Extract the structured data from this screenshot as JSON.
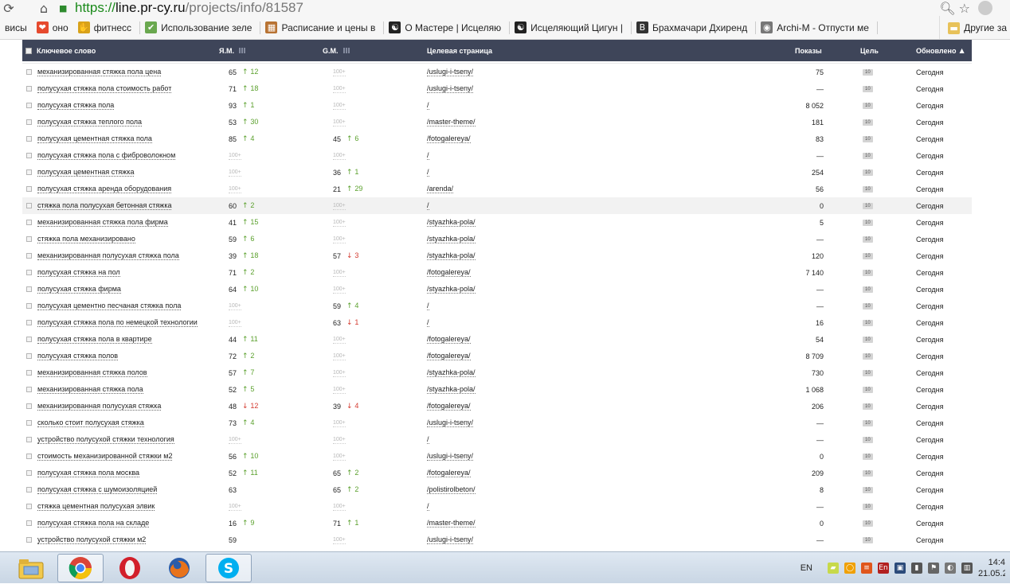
{
  "browser": {
    "url_scheme": "https://",
    "url_host": "line.pr-cy.ru",
    "url_path": "/projects/info/81587",
    "back_icon": "⟳",
    "home_icon": "⌂"
  },
  "bookmarks": {
    "items": [
      {
        "label": "висы",
        "icon": "",
        "color": "#f6f6f6"
      },
      {
        "label": "оно",
        "icon": "❤",
        "color": "#e64a2e"
      },
      {
        "label": "фитнесс",
        "icon": "✋",
        "color": "#d8a21a"
      },
      {
        "label": "Использование зеле",
        "icon": "✔",
        "color": "#6aa84f"
      },
      {
        "label": "Расписание и цены в",
        "icon": "▦",
        "color": "#b87333"
      },
      {
        "label": "О Мастере | Исцеляю",
        "icon": "☯",
        "color": "#222222"
      },
      {
        "label": "Исцеляющий Цигун |",
        "icon": "☯",
        "color": "#222222"
      },
      {
        "label": "Брахмачари Дхиренд",
        "icon": "B",
        "color": "#333333"
      },
      {
        "label": "Archi-M - Отпусти ме",
        "icon": "◉",
        "color": "#777777"
      }
    ],
    "other_label": "Другие за"
  },
  "table": {
    "headers": {
      "keyword": "Ключевое слово",
      "ym": "Я.М.",
      "gm": "G.M.",
      "target": "Целевая страница",
      "shows": "Показы",
      "goal": "Цель",
      "updated": "Обновлено",
      "sort_arrow": "▲"
    },
    "none_label": "100+",
    "rows": [
      {
        "kw": "механизированная стяжка пола цена",
        "ym": "65",
        "ym_dir": "up",
        "ym_delta": "12",
        "gm": "",
        "gm_dir": "",
        "gm_delta": "",
        "page": "/uslugi-i-tseny/",
        "shows": "75",
        "goal": "10",
        "updated": "Сегодня"
      },
      {
        "kw": "полусухая стяжка пола стоимость работ",
        "ym": "71",
        "ym_dir": "up",
        "ym_delta": "18",
        "gm": "",
        "gm_dir": "",
        "gm_delta": "",
        "page": "/uslugi-i-tseny/",
        "shows": "—",
        "goal": "10",
        "updated": "Сегодня"
      },
      {
        "kw": "полусухая стяжка пола",
        "ym": "93",
        "ym_dir": "up",
        "ym_delta": "1",
        "gm": "",
        "gm_dir": "",
        "gm_delta": "",
        "page": "/",
        "shows": "8 052",
        "goal": "10",
        "updated": "Сегодня"
      },
      {
        "kw": "полусухая стяжка теплого пола",
        "ym": "53",
        "ym_dir": "up",
        "ym_delta": "30",
        "gm": "",
        "gm_dir": "",
        "gm_delta": "",
        "page": "/master-theme/",
        "shows": "181",
        "goal": "10",
        "updated": "Сегодня"
      },
      {
        "kw": "полусухая цементная стяжка пола",
        "ym": "85",
        "ym_dir": "up",
        "ym_delta": "4",
        "gm": "45",
        "gm_dir": "up",
        "gm_delta": "6",
        "page": "/fotogalereya/",
        "shows": "83",
        "goal": "10",
        "updated": "Сегодня"
      },
      {
        "kw": "полусухая стяжка пола с фиброволокном",
        "ym": "",
        "ym_dir": "",
        "ym_delta": "",
        "gm": "",
        "gm_dir": "",
        "gm_delta": "",
        "page": "/",
        "shows": "—",
        "goal": "10",
        "updated": "Сегодня"
      },
      {
        "kw": "полусухая цементная стяжка",
        "ym": "",
        "ym_dir": "",
        "ym_delta": "",
        "gm": "36",
        "gm_dir": "up",
        "gm_delta": "1",
        "page": "/",
        "shows": "254",
        "goal": "10",
        "updated": "Сегодня"
      },
      {
        "kw": "полусухая стяжка аренда оборудования",
        "ym": "",
        "ym_dir": "",
        "ym_delta": "",
        "gm": "21",
        "gm_dir": "up",
        "gm_delta": "29",
        "page": "/arenda/",
        "shows": "56",
        "goal": "10",
        "updated": "Сегодня"
      },
      {
        "kw": "стяжка пола полусухая бетонная стяжка",
        "ym": "60",
        "ym_dir": "up",
        "ym_delta": "2",
        "gm": "",
        "gm_dir": "",
        "gm_delta": "",
        "page": "/",
        "shows": "0",
        "goal": "10",
        "updated": "Сегодня",
        "hl": true
      },
      {
        "kw": "механизированная стяжка пола фирма",
        "ym": "41",
        "ym_dir": "up",
        "ym_delta": "15",
        "gm": "",
        "gm_dir": "",
        "gm_delta": "",
        "page": "/styazhka-pola/",
        "shows": "5",
        "goal": "10",
        "updated": "Сегодня"
      },
      {
        "kw": "стяжка пола механизировано",
        "ym": "59",
        "ym_dir": "up",
        "ym_delta": "6",
        "gm": "",
        "gm_dir": "",
        "gm_delta": "",
        "page": "/styazhka-pola/",
        "shows": "—",
        "goal": "10",
        "updated": "Сегодня"
      },
      {
        "kw": "механизированная полусухая стяжка пола",
        "ym": "39",
        "ym_dir": "up",
        "ym_delta": "18",
        "gm": "57",
        "gm_dir": "down",
        "gm_delta": "3",
        "page": "/styazhka-pola/",
        "shows": "120",
        "goal": "10",
        "updated": "Сегодня"
      },
      {
        "kw": "полусухая стяжка на пол",
        "ym": "71",
        "ym_dir": "up",
        "ym_delta": "2",
        "gm": "",
        "gm_dir": "",
        "gm_delta": "",
        "page": "/fotogalereya/",
        "shows": "7 140",
        "goal": "10",
        "updated": "Сегодня"
      },
      {
        "kw": "полусухая стяжка фирма",
        "ym": "64",
        "ym_dir": "up",
        "ym_delta": "10",
        "gm": "",
        "gm_dir": "",
        "gm_delta": "",
        "page": "/styazhka-pola/",
        "shows": "—",
        "goal": "10",
        "updated": "Сегодня"
      },
      {
        "kw": "полусухая цементно песчаная стяжка пола",
        "ym": "",
        "ym_dir": "",
        "ym_delta": "",
        "gm": "59",
        "gm_dir": "up",
        "gm_delta": "4",
        "page": "/",
        "shows": "—",
        "goal": "10",
        "updated": "Сегодня"
      },
      {
        "kw": "полусухая стяжка пола по немецкой технологии",
        "ym": "",
        "ym_dir": "",
        "ym_delta": "",
        "gm": "63",
        "gm_dir": "down",
        "gm_delta": "1",
        "page": "/",
        "shows": "16",
        "goal": "10",
        "updated": "Сегодня"
      },
      {
        "kw": "полусухая стяжка пола в квартире",
        "ym": "44",
        "ym_dir": "up",
        "ym_delta": "11",
        "gm": "",
        "gm_dir": "",
        "gm_delta": "",
        "page": "/fotogalereya/",
        "shows": "54",
        "goal": "10",
        "updated": "Сегодня"
      },
      {
        "kw": "полусухая стяжка полов",
        "ym": "72",
        "ym_dir": "up",
        "ym_delta": "2",
        "gm": "",
        "gm_dir": "",
        "gm_delta": "",
        "page": "/fotogalereya/",
        "shows": "8 709",
        "goal": "10",
        "updated": "Сегодня"
      },
      {
        "kw": "механизированная стяжка полов",
        "ym": "57",
        "ym_dir": "up",
        "ym_delta": "7",
        "gm": "",
        "gm_dir": "",
        "gm_delta": "",
        "page": "/styazhka-pola/",
        "shows": "730",
        "goal": "10",
        "updated": "Сегодня"
      },
      {
        "kw": "механизированная стяжка пола",
        "ym": "52",
        "ym_dir": "up",
        "ym_delta": "5",
        "gm": "",
        "gm_dir": "",
        "gm_delta": "",
        "page": "/styazhka-pola/",
        "shows": "1 068",
        "goal": "10",
        "updated": "Сегодня"
      },
      {
        "kw": "механизированная полусухая стяжка",
        "ym": "48",
        "ym_dir": "down",
        "ym_delta": "12",
        "gm": "39",
        "gm_dir": "down",
        "gm_delta": "4",
        "page": "/fotogalereya/",
        "shows": "206",
        "goal": "10",
        "updated": "Сегодня"
      },
      {
        "kw": "сколько стоит полусухая стяжка",
        "ym": "73",
        "ym_dir": "up",
        "ym_delta": "4",
        "gm": "",
        "gm_dir": "",
        "gm_delta": "",
        "page": "/uslugi-i-tseny/",
        "shows": "—",
        "goal": "10",
        "updated": "Сегодня"
      },
      {
        "kw": "устройство полусухой стяжки технология",
        "ym": "",
        "ym_dir": "",
        "ym_delta": "",
        "gm": "",
        "gm_dir": "",
        "gm_delta": "",
        "page": "/",
        "shows": "—",
        "goal": "10",
        "updated": "Сегодня"
      },
      {
        "kw": "стоимость механизированной стяжки м2",
        "ym": "56",
        "ym_dir": "up",
        "ym_delta": "10",
        "gm": "",
        "gm_dir": "",
        "gm_delta": "",
        "page": "/uslugi-i-tseny/",
        "shows": "0",
        "goal": "10",
        "updated": "Сегодня"
      },
      {
        "kw": "полусухая стяжка пола москва",
        "ym": "52",
        "ym_dir": "up",
        "ym_delta": "11",
        "gm": "65",
        "gm_dir": "up",
        "gm_delta": "2",
        "page": "/fotogalereya/",
        "shows": "209",
        "goal": "10",
        "updated": "Сегодня"
      },
      {
        "kw": "полусухая стяжка с шумоизоляцией",
        "ym": "63",
        "ym_dir": "",
        "ym_delta": "",
        "gm": "65",
        "gm_dir": "up",
        "gm_delta": "2",
        "page": "/polistirolbeton/",
        "shows": "8",
        "goal": "10",
        "updated": "Сегодня"
      },
      {
        "kw": "стяжка цементная полусухая элвик",
        "ym": "",
        "ym_dir": "",
        "ym_delta": "",
        "gm": "",
        "gm_dir": "",
        "gm_delta": "",
        "page": "/",
        "shows": "—",
        "goal": "10",
        "updated": "Сегодня"
      },
      {
        "kw": "полусухая стяжка пола на складе",
        "ym": "16",
        "ym_dir": "up",
        "ym_delta": "9",
        "gm": "71",
        "gm_dir": "up",
        "gm_delta": "1",
        "page": "/master-theme/",
        "shows": "0",
        "goal": "10",
        "updated": "Сегодня"
      },
      {
        "kw": "устройство полусухой стяжки м2",
        "ym": "59",
        "ym_dir": "",
        "ym_delta": "",
        "gm": "",
        "gm_dir": "",
        "gm_delta": "",
        "page": "/uslugi-i-tseny/",
        "shows": "—",
        "goal": "10",
        "updated": "Сегодня"
      }
    ]
  },
  "taskbar": {
    "apps": [
      {
        "name": "file-explorer",
        "icon": "folder-icon"
      },
      {
        "name": "chrome",
        "icon": "chrome-icon",
        "active": true
      },
      {
        "name": "opera",
        "icon": "opera-icon"
      },
      {
        "name": "firefox",
        "icon": "firefox-icon"
      },
      {
        "name": "skype",
        "icon": "skype-icon",
        "active": true
      }
    ],
    "lang": "EN",
    "time": "14:4",
    "date": "21.05.2"
  }
}
